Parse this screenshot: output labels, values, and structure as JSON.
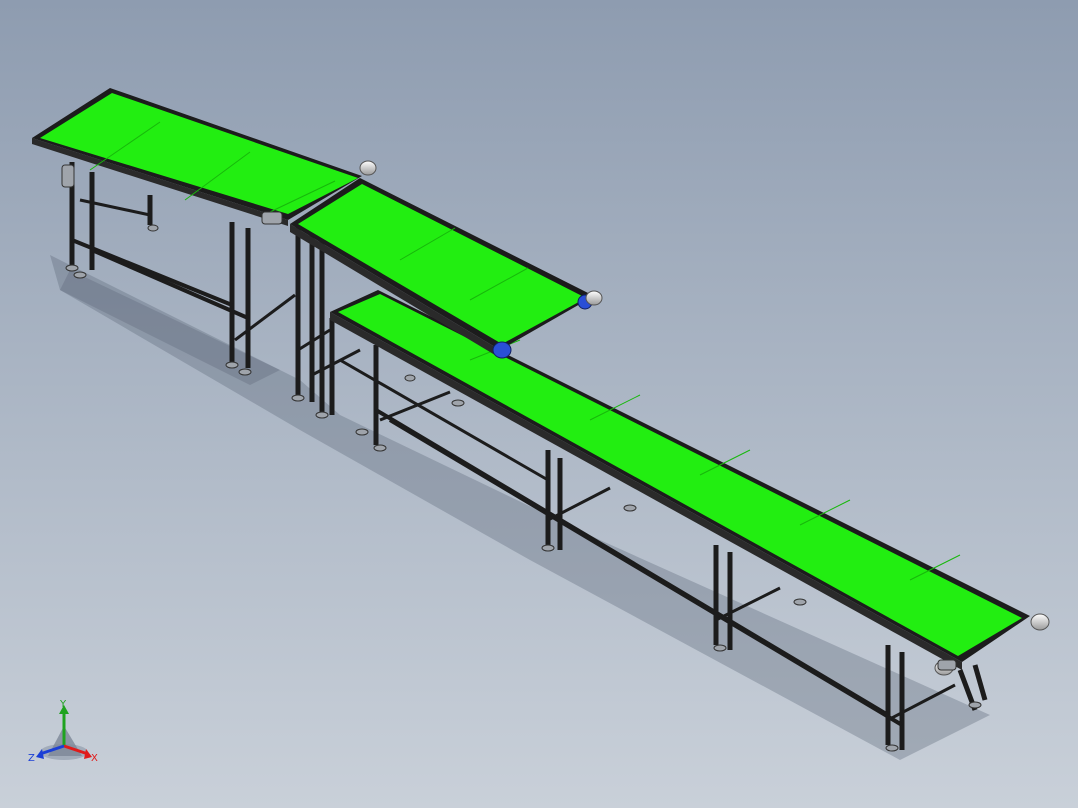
{
  "scene": {
    "model": "belt-conveyor-assembly",
    "belt_color": "#22ee11",
    "frame_color": "#1c1c1c",
    "roller_color": "#d8d8d8",
    "drive_color": "#2a4fd6",
    "background_top": "#8e9cb0",
    "background_bottom": "#c9d0d9"
  },
  "triad": {
    "x_label": "X",
    "y_label": "Y",
    "z_label": "Z",
    "x_color": "#e01b1b",
    "y_color": "#1fa31f",
    "z_color": "#1b3fd6"
  }
}
